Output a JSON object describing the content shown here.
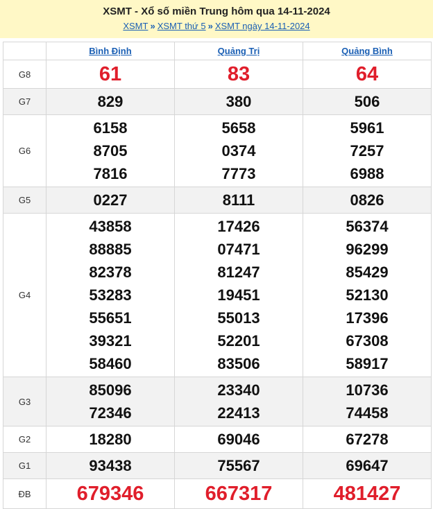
{
  "header": {
    "title": "XSMT - Xổ số miền Trung hôm qua 14-11-2024",
    "breadcrumb": [
      {
        "label": "XSMT"
      },
      {
        "label": "XSMT thứ 5"
      },
      {
        "label": "XSMT ngày 14-11-2024"
      }
    ],
    "separator": "»"
  },
  "provinces": [
    "Bình Định",
    "Quảng Trị",
    "Quảng Bình"
  ],
  "prizes": [
    {
      "label": "G8",
      "results": [
        [
          "61"
        ],
        [
          "83"
        ],
        [
          "64"
        ]
      ]
    },
    {
      "label": "G7",
      "results": [
        [
          "829"
        ],
        [
          "380"
        ],
        [
          "506"
        ]
      ]
    },
    {
      "label": "G6",
      "results": [
        [
          "6158",
          "8705",
          "7816"
        ],
        [
          "5658",
          "0374",
          "7773"
        ],
        [
          "5961",
          "7257",
          "6988"
        ]
      ]
    },
    {
      "label": "G5",
      "results": [
        [
          "0227"
        ],
        [
          "8111"
        ],
        [
          "0826"
        ]
      ]
    },
    {
      "label": "G4",
      "results": [
        [
          "43858",
          "88885",
          "82378",
          "53283",
          "55651",
          "39321",
          "58460"
        ],
        [
          "17426",
          "07471",
          "81247",
          "19451",
          "55013",
          "52201",
          "83506"
        ],
        [
          "56374",
          "96299",
          "85429",
          "52130",
          "17396",
          "67308",
          "58917"
        ]
      ]
    },
    {
      "label": "G3",
      "results": [
        [
          "85096",
          "72346"
        ],
        [
          "23340",
          "22413"
        ],
        [
          "10736",
          "74458"
        ]
      ]
    },
    {
      "label": "G2",
      "results": [
        [
          "18280"
        ],
        [
          "69046"
        ],
        [
          "67278"
        ]
      ]
    },
    {
      "label": "G1",
      "results": [
        [
          "93438"
        ],
        [
          "75567"
        ],
        [
          "69647"
        ]
      ]
    },
    {
      "label": "ĐB",
      "results": [
        [
          "679346"
        ],
        [
          "667317"
        ],
        [
          "481427"
        ]
      ]
    }
  ],
  "colors": {
    "header_bg": "#fff8c6",
    "link": "#1a5fb4",
    "highlight": "#e01e2b",
    "alt_row": "#f2f2f2"
  }
}
